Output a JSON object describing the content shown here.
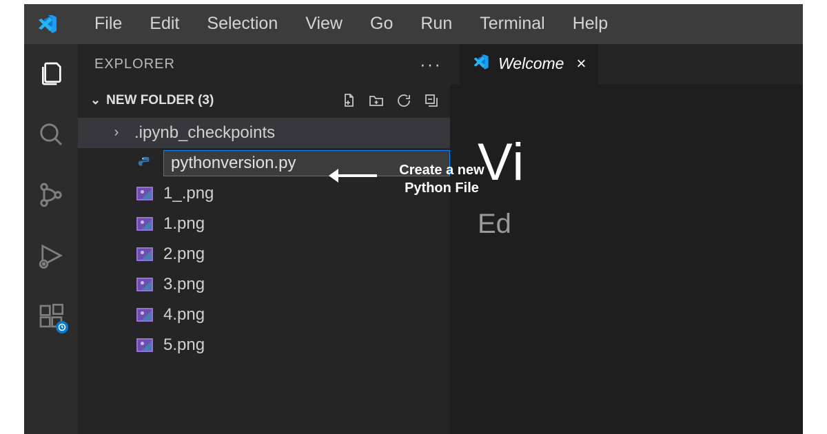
{
  "menu": {
    "file": "File",
    "edit": "Edit",
    "selection": "Selection",
    "view": "View",
    "go": "Go",
    "run": "Run",
    "terminal": "Terminal",
    "help": "Help"
  },
  "sidebar": {
    "title": "EXPLORER",
    "folder_label": "NEW FOLDER (3)",
    "items": {
      "checkpoints": ".ipynb_checkpoints",
      "newfile_value": "pythonversion.py",
      "f1": "1_.png",
      "f2": "1.png",
      "f3": "2.png",
      "f4": "3.png",
      "f5": "4.png",
      "f6": "5.png"
    }
  },
  "tab": {
    "label": "Welcome"
  },
  "editor": {
    "title_fragment": "Vi",
    "subtitle_fragment": "Ed"
  },
  "annotation": {
    "text": "Create a new Python File"
  }
}
